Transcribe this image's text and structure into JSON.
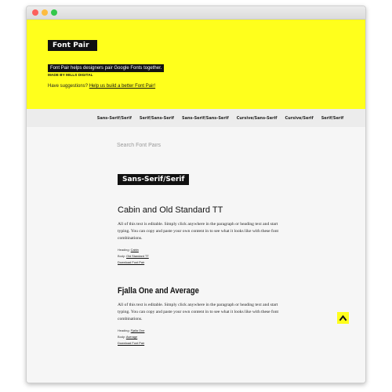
{
  "hero": {
    "logo": "Font Pair",
    "tagline": "Font Pair helps designers pair Google Fonts together.",
    "made_by": "MADE BY MILLS DIGITAL",
    "suggest_text": "Have suggestions?",
    "suggest_link": "Help us build a better Font Pair!"
  },
  "nav": {
    "items": [
      {
        "label": "Sans-Serif/Serif"
      },
      {
        "label": "Serif/Sans-Serif"
      },
      {
        "label": "Sans-Serif/Sans-Serif"
      },
      {
        "label": "Cursive/Sans-Serif"
      },
      {
        "label": "Cursive/Serif"
      },
      {
        "label": "Serif/Serif"
      }
    ]
  },
  "search": {
    "placeholder": "Search Font Pairs"
  },
  "section": {
    "title": "Sans-Serif/Serif"
  },
  "pairs": [
    {
      "title": "Cabin and Old Standard TT",
      "body": "All of this text is editable. Simply click anywhere in the paragraph or heading text and start typing. You can copy and paste your own content in to see what it looks like with these font combinations.",
      "heading_label": "Heading:",
      "heading_font": "Cabin",
      "body_label": "Body:",
      "body_font": "Old Standard TT",
      "download": "Download Font Pair"
    },
    {
      "title": "Fjalla One and Average",
      "body": "All of this text is editable. Simply click anywhere in the paragraph or heading text and start typing. You can copy and paste your own content in to see what it looks like with these font combinations.",
      "heading_label": "Heading:",
      "heading_font": "Fjalla One",
      "body_label": "Body:",
      "body_font": "Average",
      "download": "Download Font Pair"
    }
  ],
  "colors": {
    "accent": "#ffff1c",
    "dark": "#111111"
  },
  "icons": {
    "back_to_top": "chevron-up-icon"
  }
}
